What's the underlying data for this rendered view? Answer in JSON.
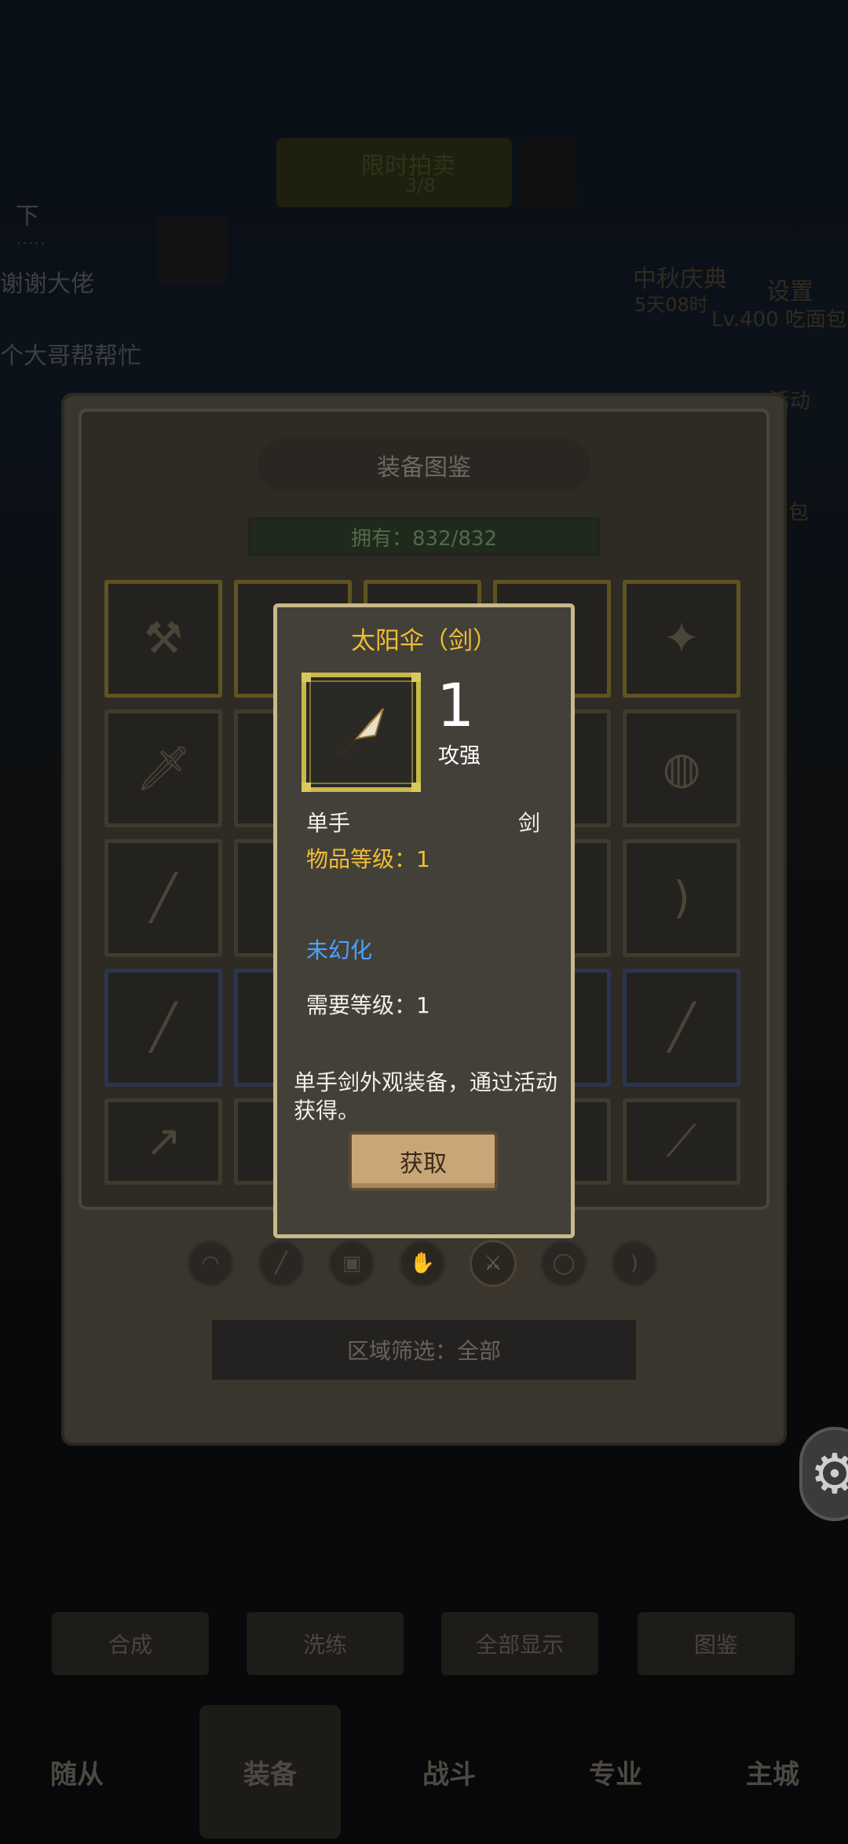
{
  "background": {
    "top_banner": "限时拍卖",
    "top_banner_sub": "3/8",
    "left_texts": [
      "下",
      "谢谢大佬",
      "个大哥帮帮忙"
    ],
    "left_green": "·····",
    "right_event": "中秋庆典",
    "right_timer": "5天08时",
    "right_settings": "设置",
    "right_level": "Lv.400 吃面包",
    "right_activity": "活动",
    "right_bag": "包",
    "subtabs": [
      "合成",
      "洗练",
      "全部显示",
      "图鉴"
    ],
    "navtabs": [
      "随从",
      "装备",
      "战斗",
      "专业",
      "主城"
    ]
  },
  "codex": {
    "title": "装备图鉴",
    "owned": "拥有：832/832",
    "filter": "区域筛选：全部"
  },
  "popup": {
    "item_name": "太阳伞（剑）",
    "attack_value": "1",
    "attack_label": "攻强",
    "hand": "单手",
    "weapon_type": "剑",
    "item_level": "物品等级：1",
    "illusion_status": "未幻化",
    "required_level": "需要等级：1",
    "description": "单手剑外观装备，通过活动获得。",
    "get_button": "获取"
  },
  "colors": {
    "title_gold": "#f0be35",
    "illusion_blue": "#4aa3ff",
    "frame_gold": "#c8b94a"
  },
  "icons": [
    "umbrella-sword-icon",
    "gear-icon"
  ]
}
